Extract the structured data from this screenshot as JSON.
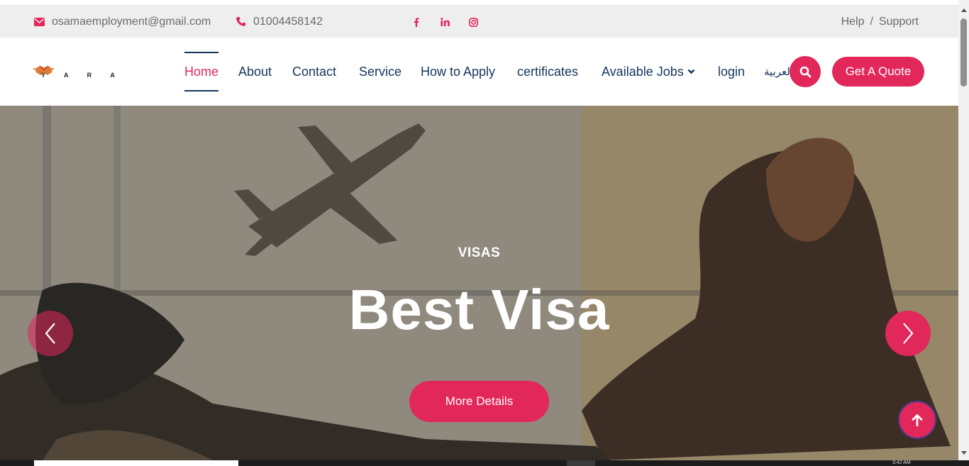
{
  "topbar": {
    "email": "osamaemployment@gmail.com",
    "phone": "01004458142",
    "social": [
      "facebook-icon",
      "linkedin-icon",
      "instagram-icon"
    ],
    "help": "Help",
    "separator": "/",
    "support": "Support"
  },
  "logo": {
    "text": "Y A R A"
  },
  "nav": {
    "items": [
      "Home",
      "About",
      "Contact",
      "Service",
      "How to Apply",
      "certificates",
      "Available Jobs",
      "login",
      "العربية"
    ],
    "active": "Home",
    "quote_label": "Get A Quote"
  },
  "hero": {
    "subtitle": "VISAS",
    "title": "Best Visa",
    "button_label": "More Details"
  },
  "taskbar": {
    "clock": "3:42 AM"
  },
  "colors": {
    "accent": "#e2275a",
    "navy": "#14365d",
    "topbar_bg": "#eeeeee"
  }
}
